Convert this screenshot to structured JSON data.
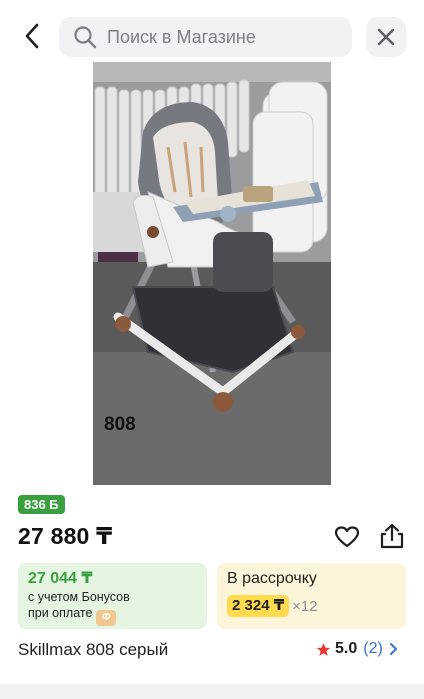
{
  "header": {
    "search_placeholder": "Поиск в Магазине"
  },
  "product": {
    "photo_caption": "808",
    "bonus_badge": "836 Б",
    "price": "27 880 ₸",
    "name": "Skillmax 808 серый"
  },
  "bonus_card": {
    "amount": "27 044 ₸",
    "line1": "с учетом Бонусов",
    "line2": "при оплате"
  },
  "installment_card": {
    "title": "В рассрочку",
    "monthly": "2 324 ₸",
    "multiplier": "×12"
  },
  "rating": {
    "value": "5.0",
    "count": "(2)"
  },
  "colors": {
    "accent_green": "#3a9f3e",
    "bonus_bg": "#e6f5e2",
    "installment_bg": "#fdf5d9",
    "installment_pill": "#ffdb4d",
    "link_blue": "#3b6fcf",
    "star_red": "#e53935"
  },
  "icons": [
    "back-icon",
    "search-icon",
    "close-icon",
    "heart-icon",
    "share-icon",
    "coin-icon",
    "star-icon",
    "chevron-right-icon"
  ]
}
